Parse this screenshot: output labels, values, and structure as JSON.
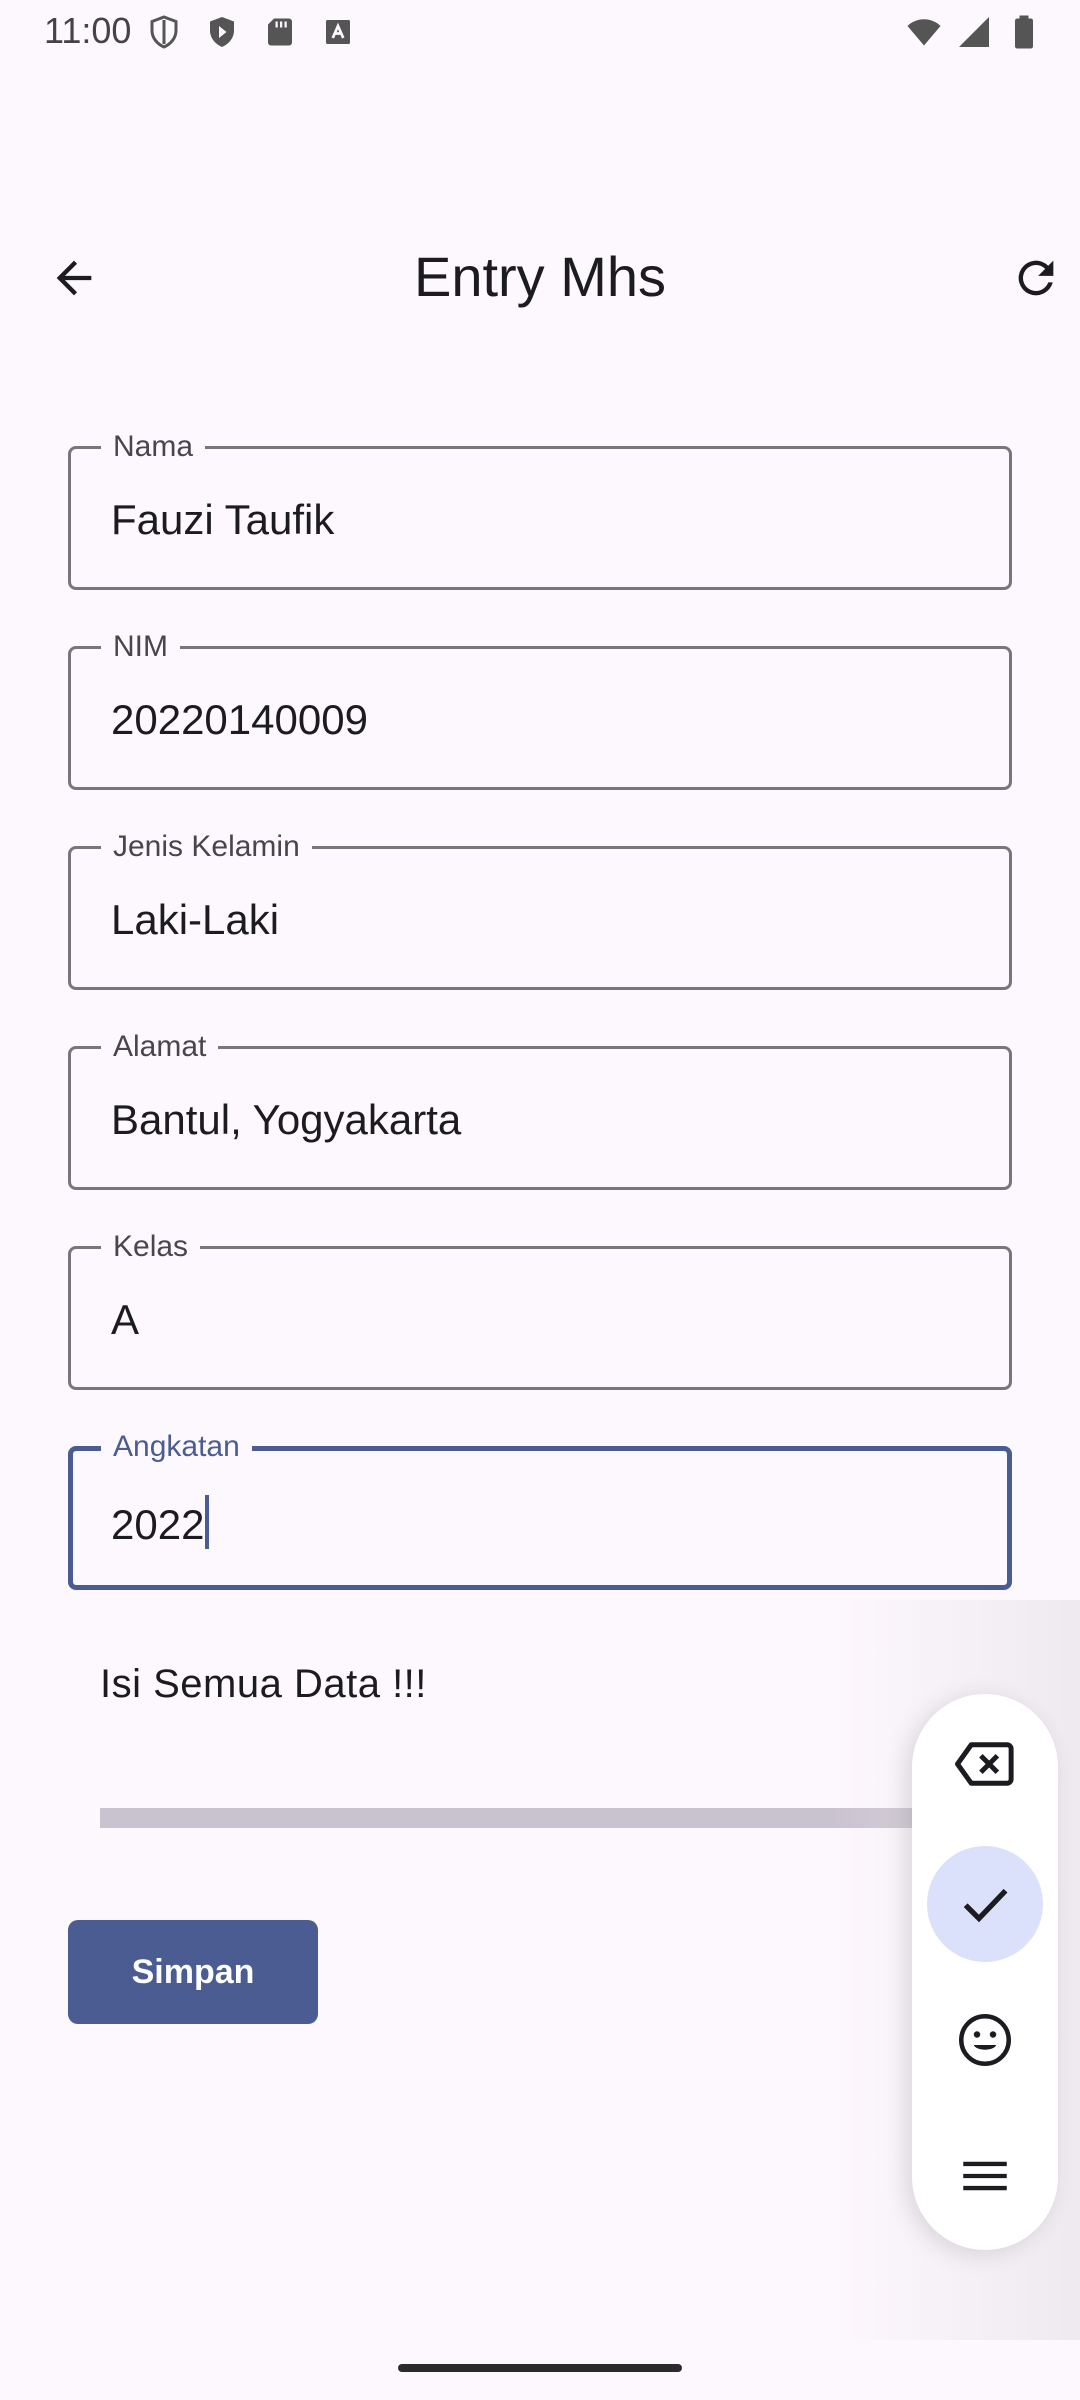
{
  "status_bar": {
    "time": "11:00",
    "left_icons": [
      "shield-icon",
      "play-protect-icon",
      "sd-card-icon",
      "keyboard-a-icon"
    ],
    "right_icons": [
      "wifi-icon",
      "signal-icon",
      "battery-icon"
    ]
  },
  "app_bar": {
    "title": "Entry Mhs",
    "back_icon": "arrow-back-icon",
    "refresh_icon": "refresh-icon"
  },
  "form": {
    "fields": [
      {
        "label": "Nama",
        "value": "Fauzi Taufik"
      },
      {
        "label": "NIM",
        "value": "20220140009"
      },
      {
        "label": "Jenis Kelamin",
        "value": "Laki-Laki"
      },
      {
        "label": "Alamat",
        "value": "Bantul, Yogyakarta"
      },
      {
        "label": "Kelas",
        "value": "A"
      },
      {
        "label": "Angkatan",
        "value": "2022",
        "focused": true
      }
    ],
    "message": "Isi Semua Data !!!",
    "save_label": "Simpan"
  },
  "keyboard_panel": {
    "buttons": [
      "backspace-icon",
      "check-icon",
      "emoji-icon",
      "menu-icon"
    ],
    "active": "check-icon"
  },
  "colors": {
    "primary": "#4a5c92",
    "background": "#fdf8fd",
    "outline": "#79747e",
    "panel_active": "#dbe1fb"
  }
}
